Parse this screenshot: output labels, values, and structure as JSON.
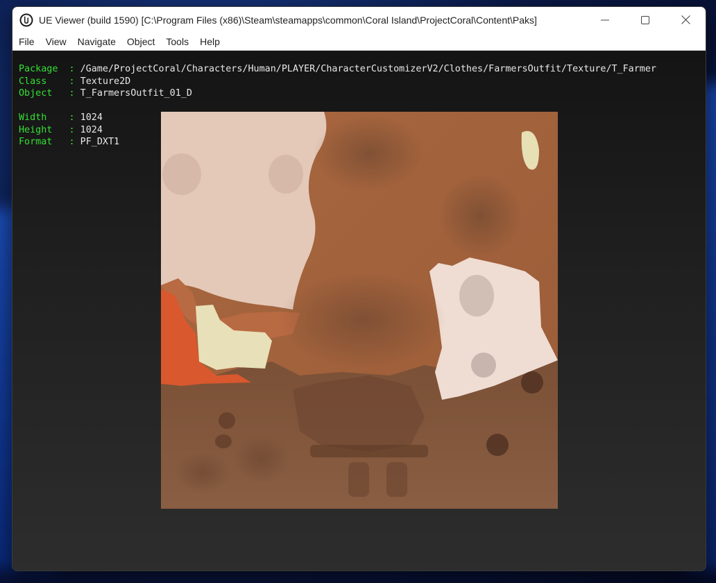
{
  "window": {
    "title": "UE Viewer (build 1590) [C:\\Program Files (x86)\\Steam\\steamapps\\common\\Coral Island\\ProjectCoral\\Content\\Paks]",
    "controls": {
      "minimize": "minimize-icon",
      "maximize": "maximize-icon",
      "close": "close-icon"
    }
  },
  "menu": [
    "File",
    "View",
    "Navigate",
    "Object",
    "Tools",
    "Help"
  ],
  "info": {
    "package_key": "Package",
    "package": "/Game/ProjectCoral/Characters/Human/PLAYER/CharacterCustomizerV2/Clothes/FarmersOutfit/Texture/T_Farmer",
    "class_key": "Class",
    "class": "Texture2D",
    "object_key": "Object",
    "object": "T_FarmersOutfit_01_D",
    "width_key": "Width",
    "width": "1024",
    "height_key": "Height",
    "height": "1024",
    "format_key": "Format",
    "format": "PF_DXT1",
    "separator": " : "
  },
  "colors": {
    "label_green": "#33e033",
    "value_white": "#e8e8e8",
    "viewport_bg": "#1f1f1f"
  }
}
